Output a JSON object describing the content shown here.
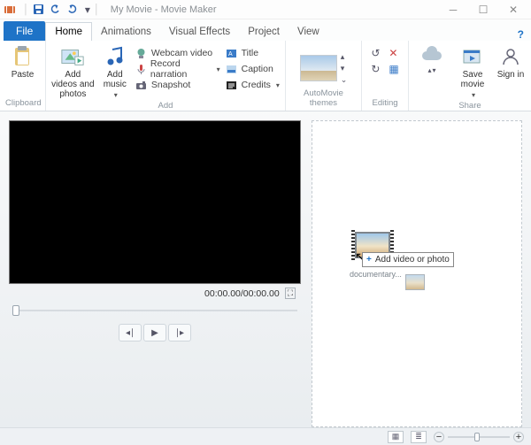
{
  "titlebar": {
    "title": "My Movie - Movie Maker"
  },
  "tabs": {
    "file": "File",
    "home": "Home",
    "animations": "Animations",
    "visual_effects": "Visual Effects",
    "project": "Project",
    "view": "View"
  },
  "ribbon": {
    "clipboard": {
      "label": "Clipboard",
      "paste": "Paste"
    },
    "add": {
      "label": "Add",
      "add_videos": "Add videos and photos",
      "add_music": "Add music",
      "webcam": "Webcam video",
      "record": "Record narration",
      "snapshot": "Snapshot",
      "title": "Title",
      "caption": "Caption",
      "credits": "Credits"
    },
    "automovie": {
      "label": "AutoMovie themes"
    },
    "editing": {
      "label": "Editing"
    },
    "share": {
      "label": "Share",
      "save_movie": "Save movie",
      "sign_in": "Sign in"
    }
  },
  "preview": {
    "timecode": "00:00.00/00:00.00"
  },
  "dropzone": {
    "tip": "Add video or photo",
    "filename": "documentary..."
  },
  "help_glyph": "?"
}
